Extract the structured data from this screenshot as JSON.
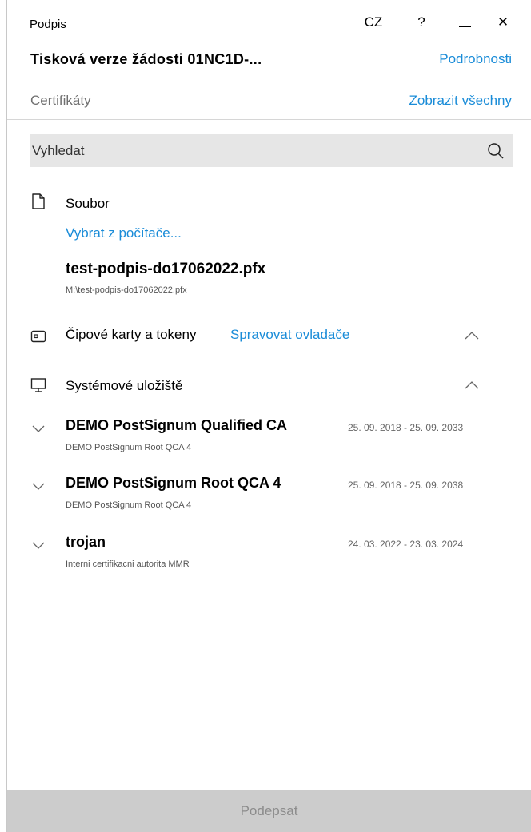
{
  "window": {
    "title": "Podpis",
    "language": "CZ",
    "help": "?",
    "close_glyph": "✕"
  },
  "header": {
    "document_title": "Tisková verze žádosti 01NC1D-...",
    "details_link": "Podrobnosti",
    "certificates_label": "Certifikáty",
    "show_all_link": "Zobrazit všechny"
  },
  "search": {
    "placeholder": "Vyhledat",
    "value": "",
    "icon": "search-icon"
  },
  "file_section": {
    "icon": "file-icon",
    "label": "Soubor",
    "choose_link": "Vybrat z počítače...",
    "file_name": "test-podpis-do17062022.pfx",
    "file_path": "M:\\test-podpis-do17062022.pfx"
  },
  "smartcard_section": {
    "icon": "smartcard-icon",
    "label": "Čipové karty a tokeny",
    "manage_link": "Spravovat ovladače",
    "expanded": true
  },
  "system_store_section": {
    "icon": "monitor-icon",
    "label": "Systémové uložiště",
    "expanded": true,
    "certificates": [
      {
        "name": "DEMO PostSignum Qualified CA",
        "issuer": "DEMO PostSignum Root QCA 4",
        "validity": "25. 09. 2018 - 25. 09. 2033"
      },
      {
        "name": "DEMO PostSignum Root QCA 4",
        "issuer": "DEMO PostSignum Root QCA 4",
        "validity": "25. 09. 2018 - 25. 09. 2038"
      },
      {
        "name": "trojan",
        "issuer": "Interni certifikacni autorita MMR",
        "validity": "24. 03. 2022 - 23. 03. 2024"
      }
    ]
  },
  "footer": {
    "sign_button": "Podepsat",
    "sign_enabled": false
  },
  "colors": {
    "link": "#1a8cd8",
    "search_bg": "#e6e6e6",
    "disabled_button_bg": "#cccccc",
    "disabled_button_text": "#8c8c8c"
  }
}
